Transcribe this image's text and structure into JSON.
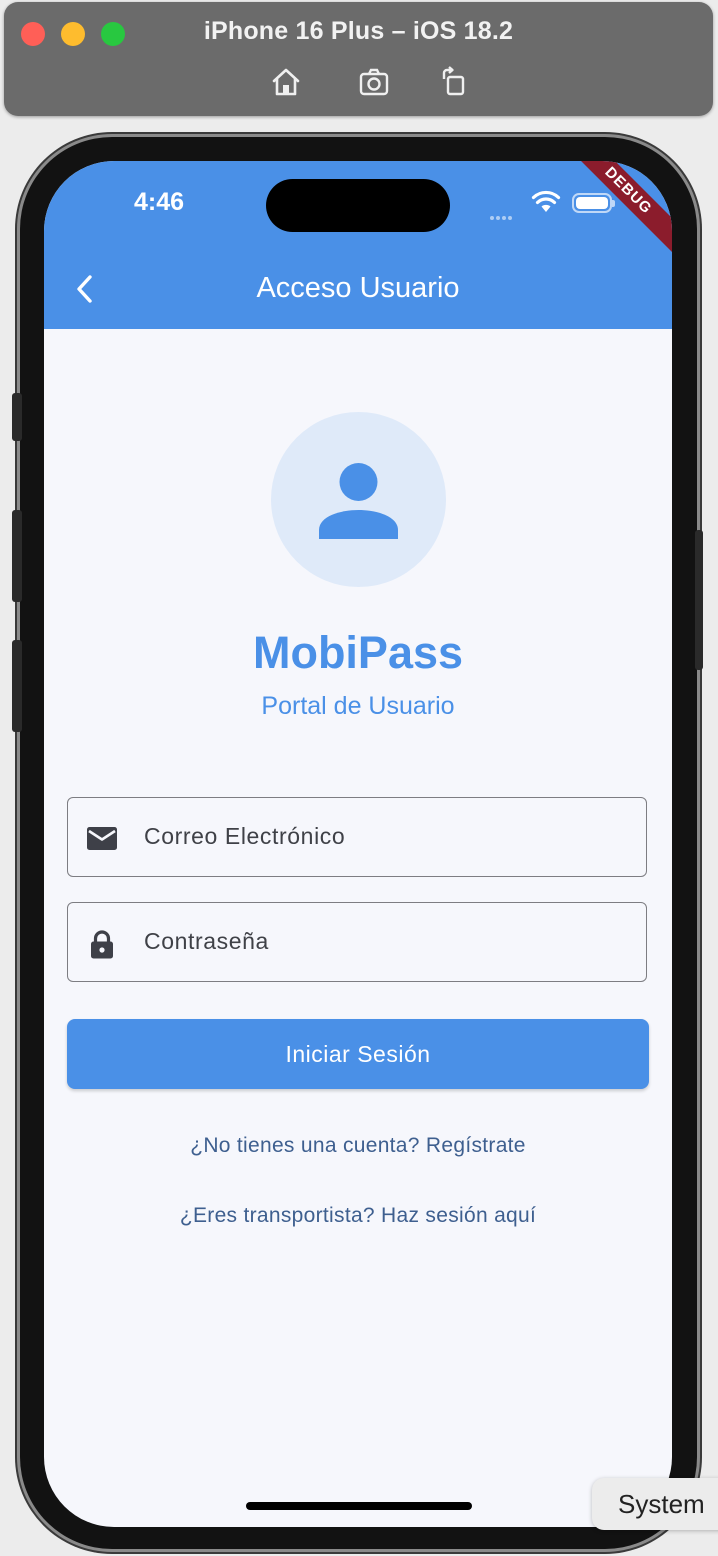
{
  "simulator": {
    "title": "iPhone 16 Plus – iOS 18.2",
    "tools": [
      "home-icon",
      "screenshot-icon",
      "rotate-icon"
    ]
  },
  "status_bar": {
    "time": "4:46",
    "debug_label": "DEBUG"
  },
  "app_bar": {
    "title": "Acceso Usuario",
    "back_icon": "chevron-left-icon"
  },
  "branding": {
    "avatar_icon": "person-icon",
    "app_name": "MobiPass",
    "subtitle": "Portal de Usuario"
  },
  "form": {
    "email": {
      "icon": "mail-icon",
      "placeholder": "Correo Electrónico",
      "value": ""
    },
    "password": {
      "icon": "lock-icon",
      "placeholder": "Contraseña",
      "value": ""
    },
    "submit_label": "Iniciar Sesión"
  },
  "links": {
    "register": "¿No tienes una cuenta? Regístrate",
    "driver_login": "¿Eres transportista? Haz sesión aquí"
  },
  "system_tab": "System",
  "colors": {
    "primary": "#4a90e7",
    "avatar_bg": "#dfeaf9",
    "background": "#f6f7fc",
    "link": "#3e5f8f",
    "debug_ribbon": "#8b1c2c"
  }
}
